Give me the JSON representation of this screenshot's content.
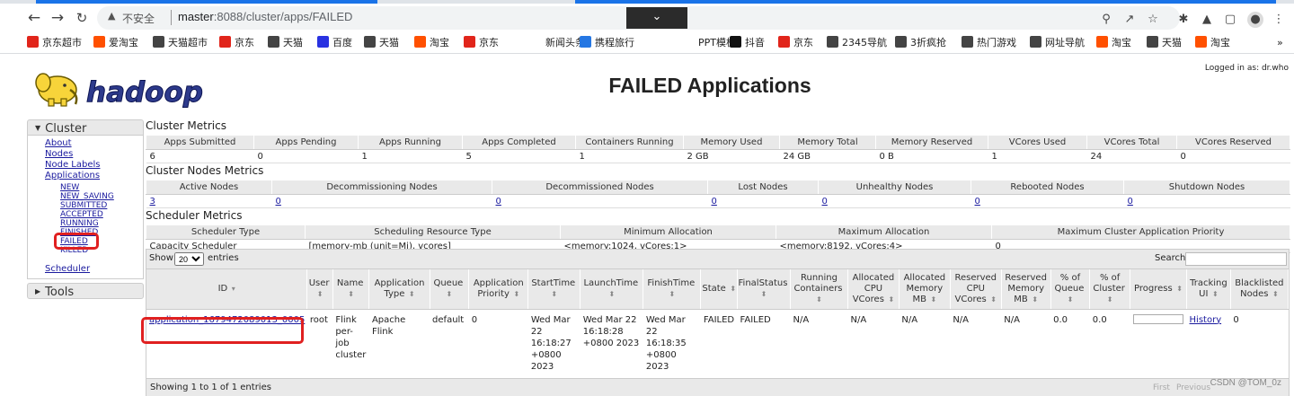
{
  "browser": {
    "insecure_label": "不安全",
    "url_host": "master",
    "url_rest": ":8088/cluster/apps/FAILED",
    "bookmarks": [
      {
        "label": "京东超市",
        "color": "#e1251b"
      },
      {
        "label": "爱淘宝",
        "color": "#ff5000"
      },
      {
        "label": "天猫超市",
        "color": "#444444"
      },
      {
        "label": "京东",
        "color": "#e1251b"
      },
      {
        "label": "天猫",
        "color": "#444444"
      },
      {
        "label": "百度",
        "color": "#2932e1"
      },
      {
        "label": "天猫",
        "color": "#444444"
      },
      {
        "label": "淘宝",
        "color": "#ff5000"
      },
      {
        "label": "京东",
        "color": "#e1251b"
      },
      {
        "label": "新闻头条",
        "color": "#ffffff"
      },
      {
        "label": "携程旅行",
        "color": "#2577e3"
      },
      {
        "label": "PPT模板",
        "color": "#ffffff"
      },
      {
        "label": "抖音",
        "color": "#111111"
      },
      {
        "label": "京东",
        "color": "#e1251b"
      },
      {
        "label": "2345导航",
        "color": "#444444"
      },
      {
        "label": "3折疯抢",
        "color": "#444444"
      },
      {
        "label": "热门游戏",
        "color": "#444444"
      },
      {
        "label": "网址导航",
        "color": "#444444"
      },
      {
        "label": "淘宝",
        "color": "#ff5000"
      },
      {
        "label": "天猫",
        "color": "#444444"
      },
      {
        "label": "淘宝",
        "color": "#ff5000"
      }
    ],
    "more_label": "»"
  },
  "page": {
    "logged_in": "Logged in as: dr.who",
    "logo_text": "hadoop",
    "title": "FAILED Applications"
  },
  "sidebar": {
    "cluster_label": "Cluster",
    "links": [
      "About",
      "Nodes",
      "Node Labels",
      "Applications"
    ],
    "states": [
      "NEW",
      "NEW_SAVING",
      "SUBMITTED",
      "ACCEPTED",
      "RUNNING",
      "FINISHED",
      "FAILED",
      "KILLED"
    ],
    "scheduler": "Scheduler",
    "tools_label": "Tools"
  },
  "cluster_metrics": {
    "title": "Cluster Metrics",
    "headers": [
      "Apps Submitted",
      "Apps Pending",
      "Apps Running",
      "Apps Completed",
      "Containers Running",
      "Memory Used",
      "Memory Total",
      "Memory Reserved",
      "VCores Used",
      "VCores Total",
      "VCores Reserved"
    ],
    "values": [
      "6",
      "0",
      "1",
      "5",
      "1",
      "2 GB",
      "24 GB",
      "0 B",
      "1",
      "24",
      "0"
    ]
  },
  "nodes_metrics": {
    "title": "Cluster Nodes Metrics",
    "headers": [
      "Active Nodes",
      "Decommissioning Nodes",
      "Decommissioned Nodes",
      "Lost Nodes",
      "Unhealthy Nodes",
      "Rebooted Nodes",
      "Shutdown Nodes"
    ],
    "values": [
      "3",
      "0",
      "0",
      "0",
      "0",
      "0",
      "0"
    ]
  },
  "scheduler_metrics": {
    "title": "Scheduler Metrics",
    "headers": [
      "Scheduler Type",
      "Scheduling Resource Type",
      "Minimum Allocation",
      "Maximum Allocation",
      "Maximum Cluster Application Priority"
    ],
    "values": [
      "Capacity Scheduler",
      "[memory-mb (unit=Mi), vcores]",
      "<memory:1024, vCores:1>",
      "<memory:8192, vCores:4>",
      "0"
    ]
  },
  "apps": {
    "show_label": "Show",
    "show_value": "20",
    "entries_label": "entries",
    "search_label": "Search:",
    "headers": [
      "ID",
      "User",
      "Name",
      "Application Type",
      "Queue",
      "Application Priority",
      "StartTime",
      "LaunchTime",
      "FinishTime",
      "State",
      "FinalStatus",
      "Running Containers",
      "Allocated CPU VCores",
      "Allocated Memory MB",
      "Reserved CPU VCores",
      "Reserved Memory MB",
      "% of Queue",
      "% of Cluster",
      "Progress",
      "Tracking UI",
      "Blacklisted Nodes"
    ],
    "row": {
      "id": "application_1679472089013_0005",
      "user": "root",
      "name": "Flink per-job cluster",
      "type": "Apache Flink",
      "queue": "default",
      "priority": "0",
      "start": "Wed Mar 22 16:18:27 +0800 2023",
      "launch": "Wed Mar 22 16:18:28 +0800 2023",
      "finish": "Wed Mar 22 16:18:35 +0800 2023",
      "state": "FAILED",
      "final_status": "FAILED",
      "running_containers": "N/A",
      "alloc_cpu": "N/A",
      "alloc_mem": "N/A",
      "res_cpu": "N/A",
      "res_mem": "N/A",
      "pct_queue": "0.0",
      "pct_cluster": "0.0",
      "progress": 0,
      "tracking": "History",
      "blacklisted": "0"
    },
    "footer": "Showing 1 to 1 of 1 entries",
    "first_label": "First",
    "prev_label": "Previous"
  },
  "watermark": "CSDN @TOM_0z"
}
